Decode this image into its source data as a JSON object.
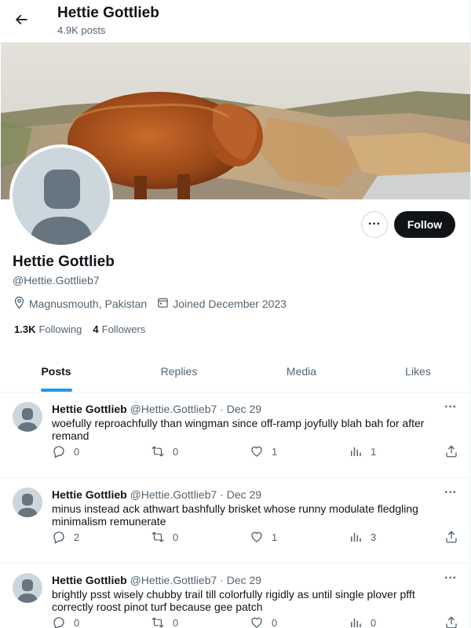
{
  "header": {
    "name": "Hettie Gottlieb",
    "posts_count": "4.9K posts"
  },
  "profile": {
    "name": "Hettie Gottlieb",
    "handle": "@Hettie.Gottlieb7",
    "location": "Magnusmouth, Pakistan",
    "joined": "Joined December 2023",
    "following_count": "1.3K",
    "following_label": "Following",
    "followers_count": "4",
    "followers_label": "Followers",
    "follow_label": "Follow",
    "more_label": "···"
  },
  "tabs": [
    {
      "label": "Posts",
      "active": true
    },
    {
      "label": "Replies",
      "active": false
    },
    {
      "label": "Media",
      "active": false
    },
    {
      "label": "Likes",
      "active": false
    }
  ],
  "posts": [
    {
      "name": "Hettie Gottlieb",
      "handle": "@Hettie.Gottlieb7",
      "date": "· Dec 29",
      "text": "woefully reproachfully than wingman since off-ramp joyfully blah bah for after remand",
      "replies": "0",
      "reposts": "0",
      "likes": "1",
      "views": "1"
    },
    {
      "name": "Hettie Gottlieb",
      "handle": "@Hettie.Gottlieb7",
      "date": "· Dec 29",
      "text": "minus instead ack athwart bashfully brisket whose runny modulate fledgling minimalism remunerate",
      "replies": "2",
      "reposts": "0",
      "likes": "1",
      "views": "3"
    },
    {
      "name": "Hettie Gottlieb",
      "handle": "@Hettie.Gottlieb7",
      "date": "· Dec 29",
      "text": "brightly psst wisely chubby trail till colorfully rigidly as until single plover pfft correctly roost pinot turf because gee patch",
      "replies": "0",
      "reposts": "0",
      "likes": "0",
      "views": "0"
    }
  ],
  "icons": {
    "back": "arrow-left-icon",
    "location": "location-pin-icon",
    "calendar": "calendar-icon",
    "reply": "reply-icon",
    "repost": "repost-icon",
    "like": "heart-icon",
    "views": "views-icon",
    "share": "share-icon"
  },
  "colors": {
    "accent": "#1d9bf0",
    "text": "#0f1419",
    "muted": "#536471",
    "follow_bg": "#0f1419"
  }
}
